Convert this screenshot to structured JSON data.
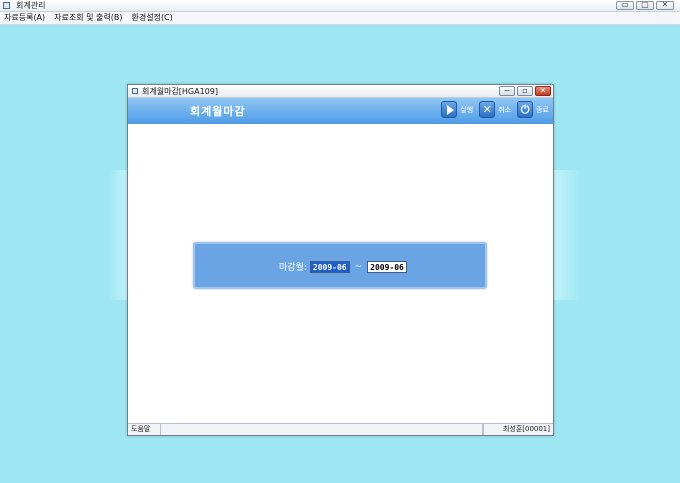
{
  "app": {
    "title": "회계관리",
    "window_buttons": {
      "minimize": "▭",
      "maximize": "▢",
      "close": "✕"
    }
  },
  "menu": {
    "items": [
      {
        "label": "자료등록(A)"
      },
      {
        "label": "자료조회 및 출력(B)"
      },
      {
        "label": "환경설정(C)"
      }
    ]
  },
  "child_window": {
    "title": "회계월마감[HGA109]",
    "buttons": {
      "minimize": "−",
      "maximize": "▫",
      "close": "✕"
    },
    "header_title": "회계월마감",
    "toolbar": {
      "run_label": "실행",
      "cancel_label": "취소",
      "exit_label": "종료"
    },
    "form": {
      "label": "마감월:",
      "from_month": "2009-06",
      "separator": "~",
      "to_month": "2009-06"
    },
    "status": {
      "help": "도움말",
      "user": "최성훈[00001]"
    }
  },
  "colors": {
    "background": "#9ee6f2",
    "header_band": "#4f9be6",
    "panel": "#6aa4e4",
    "selected_input": "#1f5fc7"
  }
}
